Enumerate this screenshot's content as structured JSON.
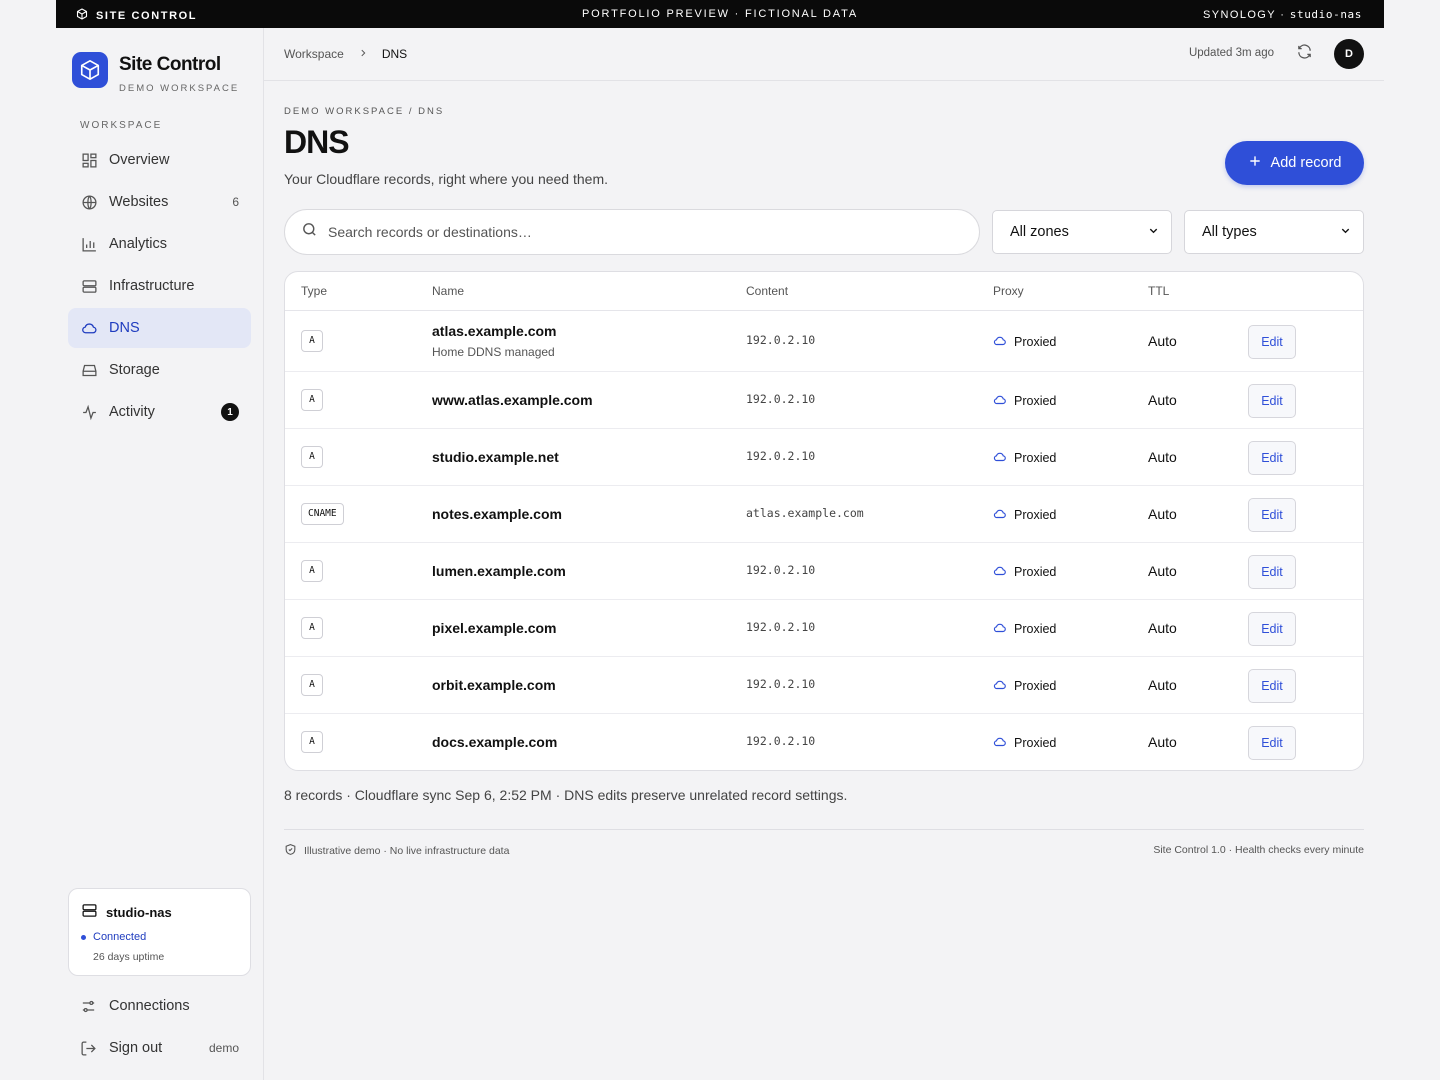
{
  "topbar": {
    "brand": "SITE CONTROL",
    "center": "PORTFOLIO PREVIEW · FICTIONAL DATA",
    "right_prefix": "SYNOLOGY · ",
    "right_host": "studio-nas"
  },
  "sidebar": {
    "brand_title": "Site Control",
    "brand_subtitle": "DEMO WORKSPACE",
    "section_label": "WORKSPACE",
    "items": [
      {
        "label": "Overview",
        "icon": "grid-icon"
      },
      {
        "label": "Websites",
        "icon": "globe-icon",
        "count": "6"
      },
      {
        "label": "Analytics",
        "icon": "bar-chart-icon"
      },
      {
        "label": "Infrastructure",
        "icon": "server-icon"
      },
      {
        "label": "DNS",
        "icon": "cloud-icon",
        "active": true
      },
      {
        "label": "Storage",
        "icon": "drive-icon"
      },
      {
        "label": "Activity",
        "icon": "pulse-icon",
        "badge": "1"
      }
    ],
    "server": {
      "name": "studio-nas",
      "status": "Connected",
      "uptime": "26 days uptime"
    },
    "connections_label": "Connections",
    "signout_label": "Sign out",
    "signout_tag": "demo"
  },
  "header": {
    "breadcrumb": [
      "Workspace",
      "DNS"
    ],
    "updated": "Updated 3m ago",
    "avatar_initial": "D"
  },
  "main": {
    "eyebrow": "DEMO WORKSPACE / DNS",
    "title": "DNS",
    "subtitle": "Your Cloudflare records, right where you need them.",
    "add_button": "Add record",
    "search_placeholder": "Search records or destinations…",
    "zone_filter": "All zones",
    "type_filter": "All types"
  },
  "table": {
    "columns": [
      "Type",
      "Name",
      "Content",
      "Proxy",
      "TTL"
    ],
    "edit_label": "Edit",
    "rows": [
      {
        "type": "A",
        "name": "atlas.example.com",
        "note": "Home DDNS managed",
        "content": "192.0.2.10",
        "proxy": "Proxied",
        "ttl": "Auto"
      },
      {
        "type": "A",
        "name": "www.atlas.example.com",
        "content": "192.0.2.10",
        "proxy": "Proxied",
        "ttl": "Auto"
      },
      {
        "type": "A",
        "name": "studio.example.net",
        "content": "192.0.2.10",
        "proxy": "Proxied",
        "ttl": "Auto"
      },
      {
        "type": "CNAME",
        "name": "notes.example.com",
        "content": "atlas.example.com",
        "proxy": "Proxied",
        "ttl": "Auto"
      },
      {
        "type": "A",
        "name": "lumen.example.com",
        "content": "192.0.2.10",
        "proxy": "Proxied",
        "ttl": "Auto"
      },
      {
        "type": "A",
        "name": "pixel.example.com",
        "content": "192.0.2.10",
        "proxy": "Proxied",
        "ttl": "Auto"
      },
      {
        "type": "A",
        "name": "orbit.example.com",
        "content": "192.0.2.10",
        "proxy": "Proxied",
        "ttl": "Auto"
      },
      {
        "type": "A",
        "name": "docs.example.com",
        "content": "192.0.2.10",
        "proxy": "Proxied",
        "ttl": "Auto"
      }
    ]
  },
  "summary": "8 records · Cloudflare sync Sep 6, 2:52 PM · DNS edits preserve unrelated record settings.",
  "footer": {
    "left": "Illustrative demo · No live infrastructure data",
    "right": "Site Control 1.0 · Health checks every minute"
  },
  "colors": {
    "accent": "#2f4fd8",
    "active_bg": "#e3e7f6",
    "topbar": "#0a0a0a"
  }
}
